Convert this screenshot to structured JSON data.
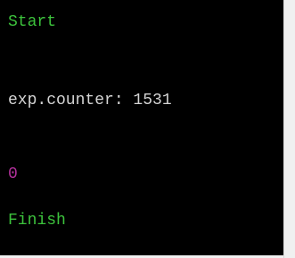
{
  "console": {
    "lines": [
      {
        "text": "Start",
        "color": "#3cc23c"
      },
      {
        "text": "exp.counter: 1531",
        "color": "#d4d4d4"
      },
      {
        "text": "0",
        "color": "#b0309a"
      },
      {
        "text": "Finish",
        "color": "#3cc23c"
      }
    ]
  }
}
